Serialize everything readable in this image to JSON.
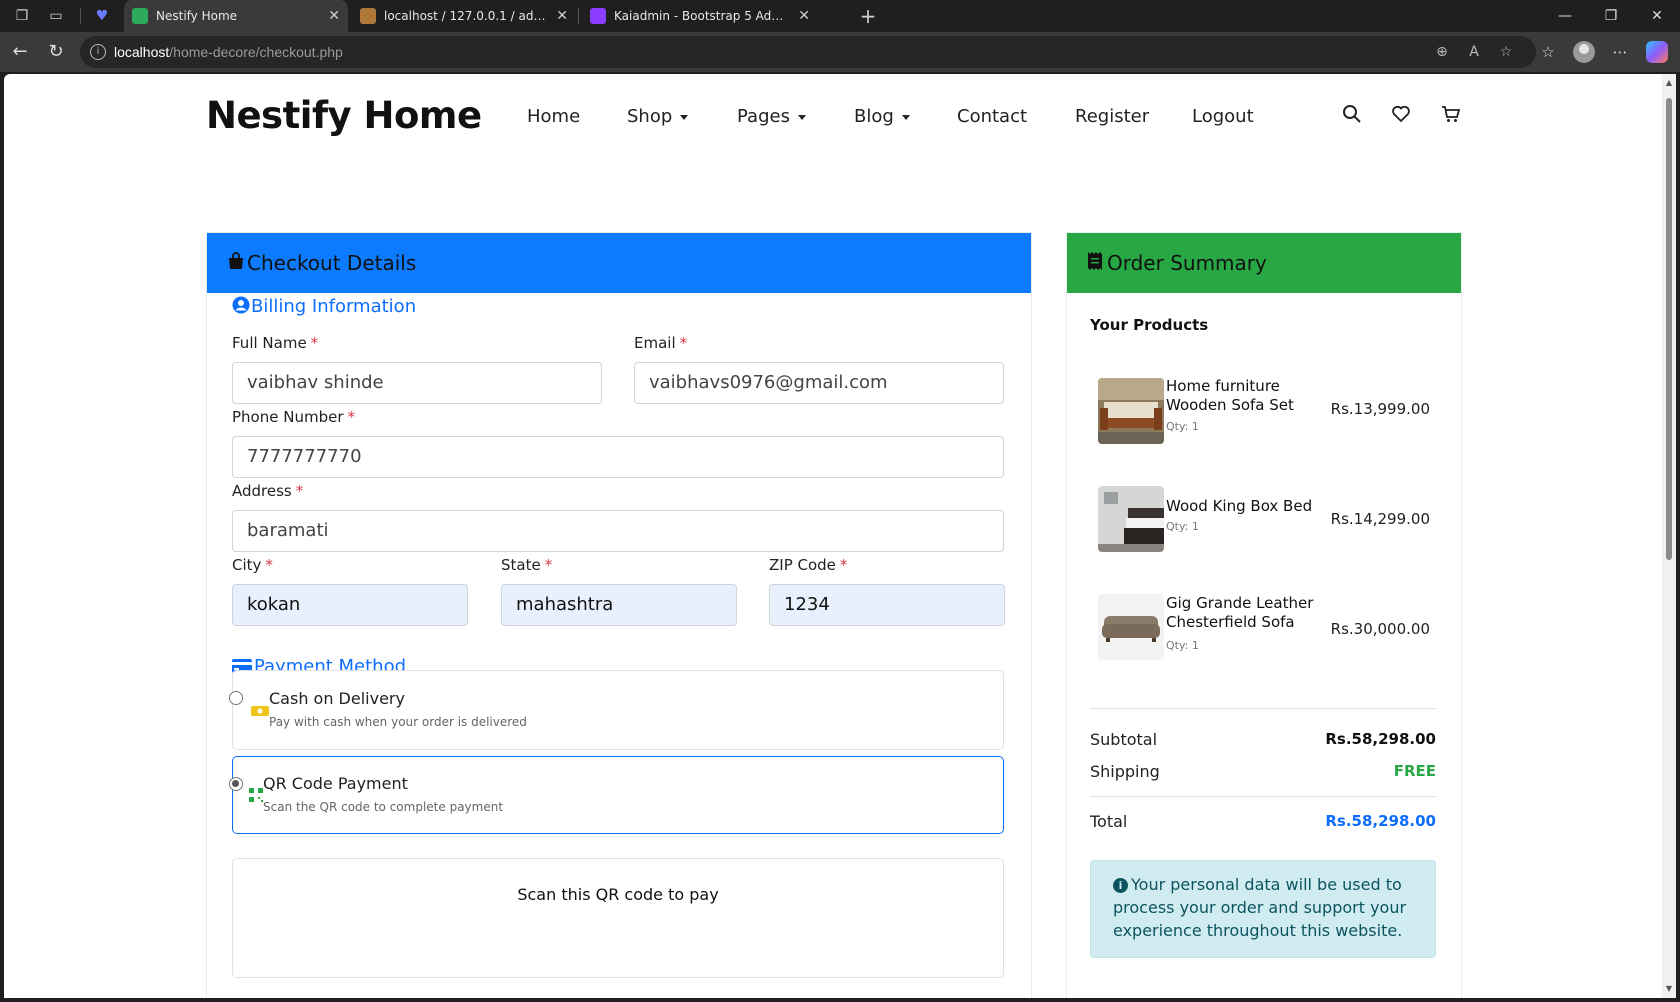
{
  "browser": {
    "tabs": [
      {
        "title": "Nestify Home",
        "active": true
      },
      {
        "title": "localhost / 127.0.0.1 / admin_home",
        "active": false
      },
      {
        "title": "Kaiadmin - Bootstrap 5 Admin Dashboard",
        "active": false
      }
    ],
    "url_host": "localhost",
    "url_path": "/home-decore/checkout.php"
  },
  "header": {
    "logo": "Nestify Home",
    "nav": [
      "Home",
      "Shop",
      "Pages",
      "Blog",
      "Contact",
      "Register",
      "Logout"
    ]
  },
  "checkout": {
    "title": "Checkout Details",
    "header_color": "#0d7bff",
    "billing_title": "Billing Information",
    "fields": {
      "full_name": {
        "label": "Full Name",
        "value": "vaibhav shinde"
      },
      "email": {
        "label": "Email",
        "value": "vaibhavs0976@gmail.com"
      },
      "phone": {
        "label": "Phone Number",
        "value": "7777777770"
      },
      "address": {
        "label": "Address",
        "value": "baramati"
      },
      "city": {
        "label": "City",
        "value": "kokan"
      },
      "state": {
        "label": "State",
        "value": "mahashtra"
      },
      "zip": {
        "label": "ZIP Code",
        "value": "1234"
      }
    },
    "required_mark": "*",
    "payment_title": "Payment Method",
    "payment_options": [
      {
        "name": "Cash on Delivery",
        "desc": "Pay with cash when your order is delivered",
        "selected": false
      },
      {
        "name": "QR Code Payment",
        "desc": "Scan the QR code to complete payment",
        "selected": true
      }
    ],
    "qr_title": "Scan this QR code to pay"
  },
  "summary": {
    "title": "Order Summary",
    "header_color": "#28a745",
    "products_heading": "Your Products",
    "products": [
      {
        "name": "Home furniture Wooden Sofa Set",
        "qty": "Qty: 1",
        "price": "Rs.13,999.00",
        "image": "sofa-set"
      },
      {
        "name": "Wood King Box Bed",
        "qty": "Qty: 1",
        "price": "Rs.14,299.00",
        "image": "box-bed"
      },
      {
        "name": "Gig Grande Leather Chesterfield Sofa",
        "qty": "Qty: 1",
        "price": "Rs.30,000.00",
        "image": "chesterfield-sofa"
      }
    ],
    "subtotal_label": "Subtotal",
    "subtotal": "Rs.58,298.00",
    "shipping_label": "Shipping",
    "shipping": "FREE",
    "total_label": "Total",
    "total": "Rs.58,298.00",
    "notice": "Your personal data will be used to process your order and support your experience throughout this website."
  }
}
